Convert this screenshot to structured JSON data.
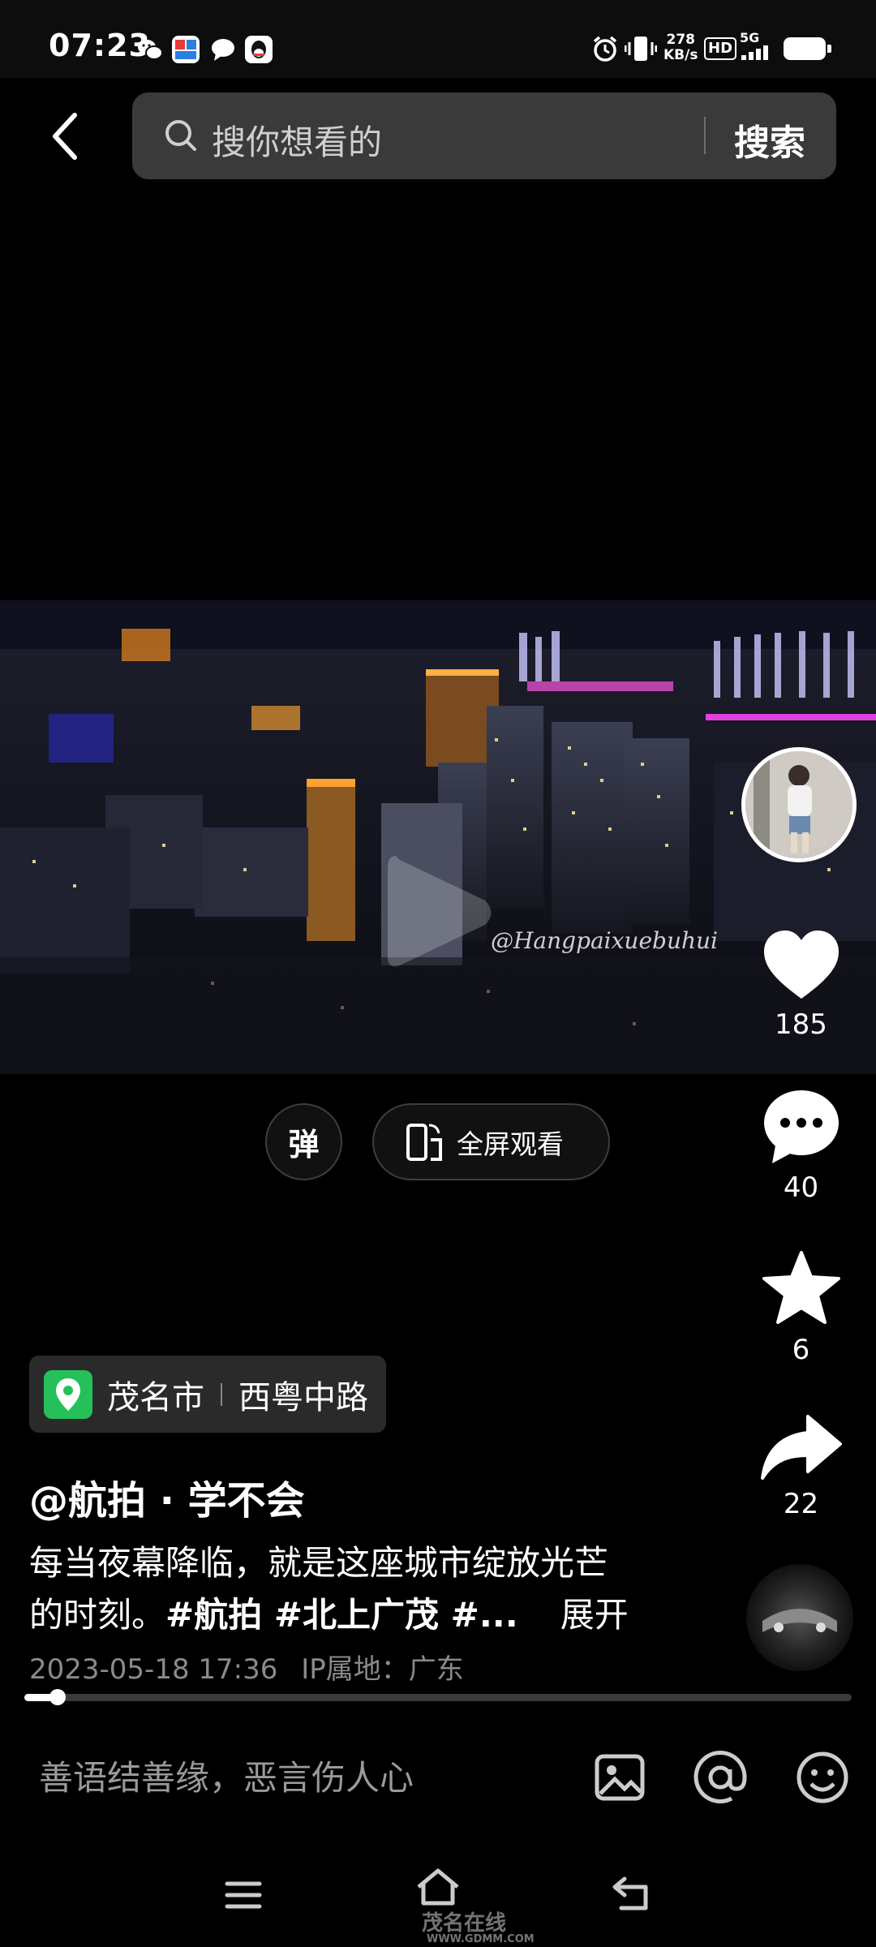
{
  "status_bar": {
    "time": "07:23",
    "net_speed_value": "278",
    "net_speed_unit": "KB/s",
    "hd": "HD",
    "network": "5G",
    "app_icons": [
      "wechat-icon",
      "alipay-icon",
      "message-icon",
      "qq-icon"
    ],
    "status_icons": [
      "alarm-icon",
      "vibrate-icon",
      "signal-icon",
      "battery-icon"
    ]
  },
  "header": {
    "search_placeholder": "搜你想看的",
    "search_button": "搜索"
  },
  "video": {
    "watermark": "@Hangpaixuebuhui"
  },
  "actions": {
    "like_count": "185",
    "comment_count": "40",
    "favorite_count": "6",
    "share_count": "22"
  },
  "controls": {
    "danmaku_label": "弹",
    "fullscreen_label": "全屏观看"
  },
  "location": {
    "city": "茂名市",
    "street": "西粤中路"
  },
  "post": {
    "author": "@航拍 · 学不会",
    "caption_line1": "每当夜幕降临，就是这座城市绽放光芒",
    "caption_line2_prefix": "的时刻。",
    "caption_tags": "#航拍 #北上广茂 #...",
    "expand": "展开",
    "timestamp": "2023-05-18 17:36",
    "ip_location": "IP属地：广东"
  },
  "progress": {
    "fraction": 0.04
  },
  "comment_bar": {
    "placeholder": "善语结善缘，恶言伤人心"
  },
  "nav": {
    "site_logo": "茂名在线",
    "site_url": "WWW.GDMM.COM"
  },
  "colors": {
    "background": "#000000",
    "search_bg": "#3a3a3a",
    "location_green": "#26c05b"
  }
}
